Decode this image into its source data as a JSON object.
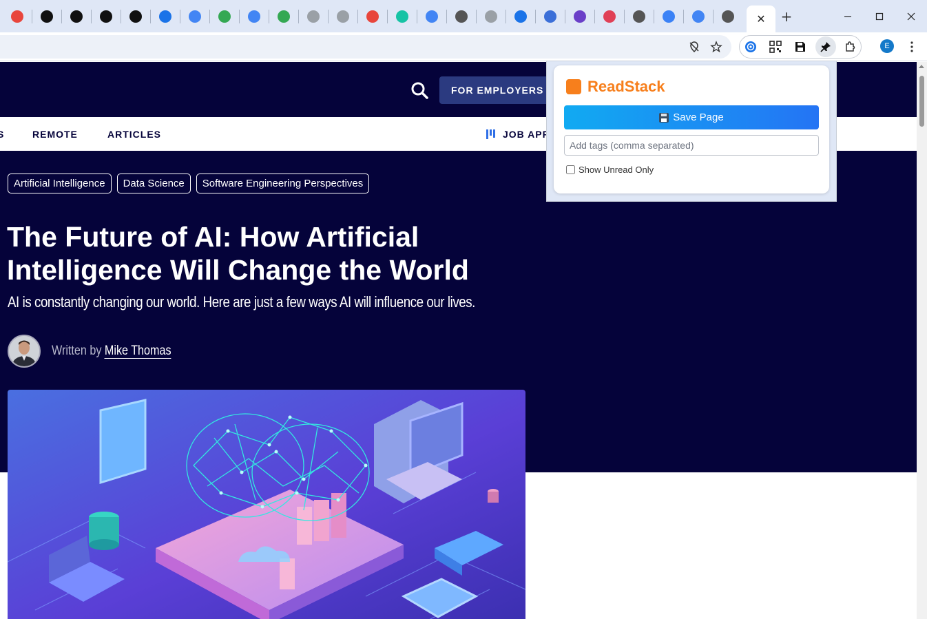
{
  "browser": {
    "tabs": [
      {
        "icon": "calendar-icon",
        "color": "#e8453c"
      },
      {
        "icon": "black-circle-icon",
        "color": "#111111"
      },
      {
        "icon": "black-circle-icon",
        "color": "#111111"
      },
      {
        "icon": "github-icon",
        "color": "#111111"
      },
      {
        "icon": "black-b-icon",
        "color": "#111111"
      },
      {
        "icon": "puzzle-icon",
        "color": "#1a73e8"
      },
      {
        "icon": "google-icon",
        "color": "#4285f4"
      },
      {
        "icon": "chrome-icon",
        "color": "#34a853"
      },
      {
        "icon": "google-icon",
        "color": "#4285f4"
      },
      {
        "icon": "chrome-icon",
        "color": "#34a853"
      },
      {
        "icon": "gray-circle-icon",
        "color": "#9aa0a6"
      },
      {
        "icon": "gray-circle-icon",
        "color": "#9aa0a6"
      },
      {
        "icon": "gauge-icon",
        "color": "#e8453c"
      },
      {
        "icon": "triangle-v-icon",
        "color": "#16c3a5"
      },
      {
        "icon": "google-icon",
        "color": "#4285f4"
      },
      {
        "icon": "globe-icon",
        "color": "#555555"
      },
      {
        "icon": "gray-circle-icon",
        "color": "#9aa0a6"
      },
      {
        "icon": "x-circle-icon",
        "color": "#1a73e8"
      },
      {
        "icon": "heart-icon",
        "color": "#3b6fd8"
      },
      {
        "icon": "a-circle-icon",
        "color": "#6a3fc8"
      },
      {
        "icon": "p-circle-icon",
        "color": "#e04056"
      },
      {
        "icon": "globe-icon",
        "color": "#555555"
      },
      {
        "icon": "colorful-icon",
        "color": "#3b82f6"
      },
      {
        "icon": "google-icon",
        "color": "#4285f4"
      },
      {
        "icon": "globe-icon",
        "color": "#555555"
      }
    ],
    "active_tab_close": "✕",
    "new_tab": "+",
    "window": {
      "minimize": "—",
      "maximize": "☐",
      "close": "✕"
    },
    "profile_initial": "E"
  },
  "site": {
    "employers_button": "FOR EMPLOYERS",
    "nav": {
      "partial": "S",
      "remote": "REMOTE",
      "articles": "ARTICLES",
      "job_app": "JOB APP"
    },
    "tags": [
      "Artificial Intelligence",
      "Data Science",
      "Software Engineering Perspectives"
    ],
    "title": "The Future of AI: How Artificial Intelligence Will Change the World",
    "subtitle": "AI is constantly changing our world. Here are just a few ways AI will influence our lives.",
    "byline_prefix": "Written by",
    "author": "Mike Thomas",
    "colors": {
      "navy": "#05033a",
      "button": "#2b3a80"
    }
  },
  "popup": {
    "app_name": "ReadStack",
    "save_button": "Save Page",
    "tags_placeholder": "Add tags (comma separated)",
    "unread_label": "Show Unread Only",
    "unread_checked": false,
    "colors": {
      "brand": "#f77f1c",
      "button_start": "#11aaf2",
      "button_end": "#2474f4"
    }
  }
}
